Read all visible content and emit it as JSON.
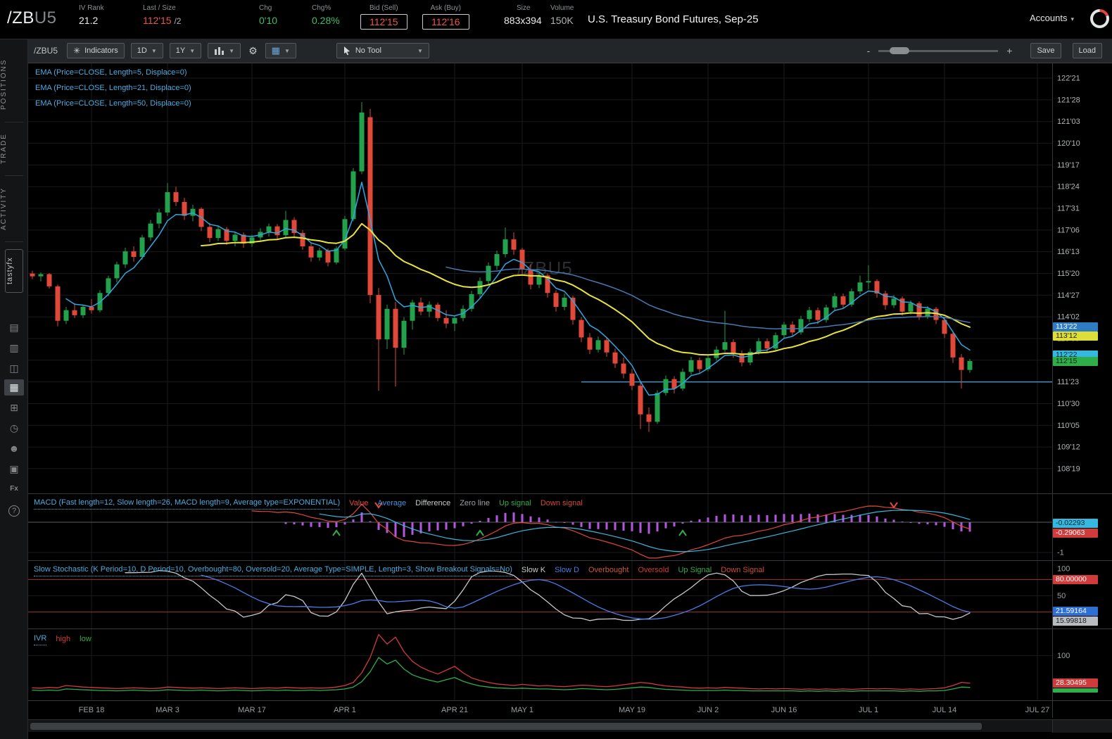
{
  "header": {
    "symbol": "/ZB",
    "symbol_suffix": "U5",
    "iv_rank_label": "IV Rank",
    "iv_rank": "21.2",
    "last_size_label": "Last / Size",
    "last": "112'15",
    "last_size": "/2",
    "chg_label": "Chg",
    "chg": "0'10",
    "chg_pct_label": "Chg%",
    "chg_pct": "0.28%",
    "bid_label": "Bid (Sell)",
    "bid": "112'15",
    "ask_label": "Ask (Buy)",
    "ask": "112'16",
    "size_label": "Size",
    "size": "883x394",
    "volume_label": "Volume",
    "volume": "150K",
    "title": "U.S. Treasury Bond Futures, Sep-25",
    "accounts_label": "Accounts"
  },
  "sidebar": {
    "tabs": [
      {
        "label": "POSITIONS"
      },
      {
        "label": "TRADE"
      },
      {
        "label": "ACTIVITY"
      },
      {
        "label": "tastyfx"
      }
    ],
    "icons": [
      {
        "name": "statement-icon",
        "glyph": "▤"
      },
      {
        "name": "watchlist-icon",
        "glyph": "▥"
      },
      {
        "name": "notes-icon",
        "glyph": "◫"
      },
      {
        "name": "chart-icon",
        "glyph": "▦",
        "active": true
      },
      {
        "name": "widgets-icon",
        "glyph": "⊞"
      },
      {
        "name": "history-icon",
        "glyph": "◷"
      },
      {
        "name": "contacts-icon",
        "glyph": "☻"
      },
      {
        "name": "calendar-icon",
        "glyph": "▣"
      },
      {
        "name": "functions-icon",
        "glyph": "Fx",
        "shape": "boxed"
      },
      {
        "name": "help-icon",
        "glyph": "?",
        "shape": "round"
      }
    ]
  },
  "toolbar": {
    "symbol_label": "/ZBU5",
    "indicators_label": "Indicators",
    "timeframe": "1D",
    "range": "1Y",
    "tool_label": "No Tool",
    "zoom_minus": "-",
    "zoom_plus": "+",
    "save_label": "Save",
    "load_label": "Load"
  },
  "chart_data": {
    "type": "candlestick",
    "symbol": "/ZBU5",
    "watermark": "/ZBU5",
    "price_format": "32nds",
    "candles": [
      [
        115.62,
        115.72,
        115.42,
        115.52
      ],
      [
        115.52,
        115.66,
        115.34,
        115.6
      ],
      [
        115.6,
        115.64,
        115.08,
        115.16
      ],
      [
        115.16,
        115.22,
        113.72,
        113.92
      ],
      [
        113.92,
        114.42,
        113.8,
        114.3
      ],
      [
        114.3,
        114.55,
        114.02,
        114.12
      ],
      [
        114.12,
        114.5,
        114.02,
        114.42
      ],
      [
        114.42,
        114.7,
        114.18,
        114.3
      ],
      [
        114.3,
        115.02,
        114.22,
        114.92
      ],
      [
        114.92,
        115.55,
        114.8,
        115.45
      ],
      [
        115.45,
        116.05,
        115.3,
        115.95
      ],
      [
        115.95,
        116.55,
        115.82,
        116.42
      ],
      [
        116.42,
        116.6,
        116.05,
        116.22
      ],
      [
        116.22,
        117.02,
        116.12,
        116.92
      ],
      [
        116.92,
        117.55,
        116.8,
        117.42
      ],
      [
        117.42,
        117.95,
        117.25,
        117.82
      ],
      [
        117.82,
        118.88,
        117.7,
        118.55
      ],
      [
        118.55,
        118.75,
        118.05,
        118.2
      ],
      [
        118.2,
        118.35,
        117.55,
        117.7
      ],
      [
        117.7,
        118.1,
        117.5,
        117.95
      ],
      [
        117.95,
        118.0,
        117.15,
        117.3
      ],
      [
        117.3,
        117.45,
        116.75,
        116.9
      ],
      [
        116.9,
        117.35,
        116.8,
        117.22
      ],
      [
        117.22,
        117.3,
        116.65,
        116.8
      ],
      [
        116.8,
        117.12,
        116.6,
        117.02
      ],
      [
        117.02,
        117.1,
        116.55,
        116.7
      ],
      [
        116.7,
        117.02,
        116.58,
        116.92
      ],
      [
        116.92,
        117.25,
        116.8,
        117.12
      ],
      [
        117.12,
        117.42,
        116.95,
        117.32
      ],
      [
        117.32,
        117.4,
        116.85,
        117.0
      ],
      [
        117.0,
        117.88,
        116.92,
        117.55
      ],
      [
        117.55,
        117.65,
        116.95,
        117.08
      ],
      [
        117.08,
        117.18,
        116.48,
        116.6
      ],
      [
        116.6,
        116.72,
        116.05,
        116.2
      ],
      [
        116.2,
        116.55,
        116.08,
        116.45
      ],
      [
        116.45,
        116.52,
        115.88,
        116.02
      ],
      [
        116.02,
        116.6,
        115.95,
        116.52
      ],
      [
        116.52,
        117.7,
        116.45,
        117.58
      ],
      [
        117.58,
        119.42,
        117.5,
        119.3
      ],
      [
        119.3,
        121.8,
        119.2,
        121.42
      ],
      [
        121.25,
        121.55,
        114.55,
        114.85
      ],
      [
        114.85,
        115.1,
        111.4,
        113.25
      ],
      [
        113.25,
        114.5,
        112.9,
        114.35
      ],
      [
        114.35,
        114.6,
        111.55,
        112.95
      ],
      [
        112.95,
        114.05,
        112.7,
        113.92
      ],
      [
        113.92,
        114.68,
        113.6,
        114.58
      ],
      [
        114.58,
        114.75,
        114.12,
        114.25
      ],
      [
        114.25,
        114.62,
        114.05,
        114.5
      ],
      [
        114.5,
        114.58,
        113.9,
        114.02
      ],
      [
        114.02,
        114.3,
        113.65,
        113.82
      ],
      [
        113.82,
        114.12,
        113.55,
        114.02
      ],
      [
        114.02,
        114.48,
        113.9,
        114.35
      ],
      [
        114.35,
        115.0,
        114.25,
        114.88
      ],
      [
        114.88,
        115.48,
        114.75,
        115.35
      ],
      [
        115.35,
        116.02,
        115.22,
        115.9
      ],
      [
        115.9,
        116.45,
        115.75,
        116.32
      ],
      [
        116.32,
        117.28,
        116.2,
        116.85
      ],
      [
        116.85,
        117.1,
        116.3,
        116.48
      ],
      [
        116.48,
        116.55,
        115.6,
        115.78
      ],
      [
        115.78,
        115.95,
        115.05,
        115.22
      ],
      [
        115.22,
        115.7,
        115.1,
        115.55
      ],
      [
        115.55,
        115.62,
        114.75,
        114.92
      ],
      [
        114.92,
        115.02,
        114.25,
        114.42
      ],
      [
        114.42,
        114.9,
        114.3,
        114.75
      ],
      [
        114.75,
        114.82,
        113.78,
        113.95
      ],
      [
        113.95,
        114.05,
        113.15,
        113.32
      ],
      [
        113.32,
        113.48,
        112.72,
        112.88
      ],
      [
        112.88,
        113.35,
        112.78,
        113.22
      ],
      [
        113.22,
        113.32,
        112.62,
        112.78
      ],
      [
        112.78,
        112.92,
        112.22,
        112.38
      ],
      [
        112.38,
        112.6,
        111.85,
        112.02
      ],
      [
        112.02,
        112.18,
        111.42,
        111.58
      ],
      [
        111.58,
        111.7,
        110.02,
        110.55
      ],
      [
        110.55,
        110.8,
        109.92,
        110.28
      ],
      [
        110.28,
        111.42,
        110.2,
        111.32
      ],
      [
        111.32,
        111.95,
        111.22,
        111.82
      ],
      [
        111.82,
        111.92,
        111.3,
        111.48
      ],
      [
        111.48,
        112.2,
        111.4,
        112.08
      ],
      [
        112.08,
        112.62,
        111.98,
        112.5
      ],
      [
        112.5,
        112.6,
        112.05,
        112.18
      ],
      [
        112.18,
        112.7,
        112.1,
        112.58
      ],
      [
        112.58,
        113.0,
        112.48,
        112.88
      ],
      [
        112.88,
        114.28,
        112.8,
        113.15
      ],
      [
        113.15,
        113.25,
        112.58,
        112.72
      ],
      [
        112.72,
        112.85,
        112.28,
        112.42
      ],
      [
        112.42,
        112.92,
        112.32,
        112.8
      ],
      [
        112.8,
        113.3,
        112.7,
        113.18
      ],
      [
        113.18,
        113.28,
        112.78,
        112.92
      ],
      [
        112.92,
        113.5,
        112.85,
        113.4
      ],
      [
        113.4,
        113.88,
        113.3,
        113.78
      ],
      [
        113.78,
        113.9,
        113.35,
        113.5
      ],
      [
        113.5,
        114.1,
        113.42,
        113.98
      ],
      [
        113.98,
        114.42,
        113.88,
        114.3
      ],
      [
        114.3,
        114.4,
        113.8,
        113.95
      ],
      [
        113.95,
        114.5,
        113.85,
        114.4
      ],
      [
        114.4,
        114.92,
        114.3,
        114.8
      ],
      [
        114.8,
        114.9,
        114.35,
        114.5
      ],
      [
        114.5,
        115.08,
        114.42,
        114.98
      ],
      [
        114.98,
        115.55,
        114.88,
        115.3
      ],
      [
        115.3,
        115.92,
        115.05,
        115.35
      ],
      [
        115.35,
        115.42,
        114.75,
        114.9
      ],
      [
        114.9,
        115.0,
        114.32,
        114.48
      ],
      [
        114.48,
        114.85,
        114.38,
        114.72
      ],
      [
        114.72,
        114.8,
        114.1,
        114.25
      ],
      [
        114.25,
        114.65,
        114.15,
        114.55
      ],
      [
        114.55,
        114.62,
        113.95,
        114.08
      ],
      [
        114.08,
        114.45,
        113.98,
        114.35
      ],
      [
        114.35,
        114.42,
        113.8,
        113.95
      ],
      [
        113.95,
        114.05,
        113.3,
        113.45
      ],
      [
        113.45,
        113.55,
        112.4,
        112.6
      ],
      [
        112.6,
        112.72,
        111.48,
        112.15
      ],
      [
        112.15,
        112.55,
        112.05,
        112.47
      ]
    ],
    "overlays": [
      {
        "name": "EMA",
        "length": 5,
        "color": "#2fa7e0"
      },
      {
        "name": "EMA",
        "length": 21,
        "color": "#e8e33c"
      },
      {
        "name": "EMA",
        "length": 50,
        "color": "#4679b2"
      }
    ],
    "legend": [
      {
        "label": "EMA (Price=CLOSE, Length=5, Displace=0)",
        "color": "#4cacdf"
      },
      {
        "label": "EMA (Price=CLOSE, Length=21, Displace=0)",
        "color": "#4cacdf"
      },
      {
        "label": "EMA (Price=CLOSE, Length=50, Displace=0)",
        "color": "#4cacdf"
      }
    ],
    "candle_up_color": "#23a24b",
    "candle_down_color": "#e0493a",
    "support_line": {
      "label": "111'23",
      "value": 111.71875,
      "start_index": 65,
      "color": "#4a90c4"
    },
    "price_axis_labels": [
      "122'21",
      "121'28",
      "121'03",
      "120'10",
      "119'17",
      "118'24",
      "117'31",
      "117'06",
      "116'13",
      "115'20",
      "114'27",
      "114'02",
      "113'09",
      "112'16",
      "111'23",
      "110'30",
      "110'05",
      "109'12",
      "108'19"
    ],
    "price_axis_tags": [
      {
        "text": "113'22",
        "value": 113.6875,
        "bg": "#2e7cc4",
        "fg": "#ffffff"
      },
      {
        "text": "113'12",
        "value": 113.375,
        "bg": "#ddde3a",
        "fg": "#1a1c00"
      },
      {
        "text": "112'22",
        "value": 112.6875,
        "bg": "#35b9e0",
        "fg": "#062530"
      },
      {
        "text": "112'15",
        "value": 112.46875,
        "bg": "#2fae4a",
        "fg": "#06230f"
      }
    ],
    "time_axis": [
      {
        "label": "FEB 18",
        "i": 7
      },
      {
        "label": "MAR 3",
        "i": 16
      },
      {
        "label": "MAR 17",
        "i": 26
      },
      {
        "label": "APR 1",
        "i": 37
      },
      {
        "label": "APR 21",
        "i": 50
      },
      {
        "label": "MAY 1",
        "i": 58
      },
      {
        "label": "MAY 19",
        "i": 71
      },
      {
        "label": "JUN 2",
        "i": 80
      },
      {
        "label": "JUN 16",
        "i": 89
      },
      {
        "label": "JUL 1",
        "i": 99
      },
      {
        "label": "JUL 14",
        "i": 108
      },
      {
        "label": "JUL 27",
        "i": 119
      }
    ],
    "macd": {
      "title": "MACD (Fast length=12, Slow length=26, MACD length=9, Average type=EXPONENTIAL)",
      "title_color": "#4cacdf",
      "items": [
        {
          "label": "Value",
          "color": "#e0483c"
        },
        {
          "label": "Average",
          "color": "#4a90d9"
        },
        {
          "label": "Difference",
          "color": "#c8cbcd"
        },
        {
          "label": "Zero line",
          "color": "#9ca0a3"
        },
        {
          "label": "Up signal",
          "color": "#2fae4a"
        },
        {
          "label": "Down signal",
          "color": "#d04a3a"
        }
      ],
      "fast_length": 12,
      "slow_length": 26,
      "macd_length": 9,
      "value_color": "#e0483c",
      "average_color": "#35b9e0",
      "histogram_color": "#b358de",
      "up_signals": [
        36,
        53,
        77
      ],
      "down_signals": [
        41,
        102
      ],
      "axis_tags": [
        {
          "text": "-0.02293",
          "value": -0.02293,
          "bg": "#35b9e0",
          "fg": "#07222b"
        },
        {
          "text": "-0.29063",
          "value": -0.29063,
          "bg": "#d23b3b",
          "fg": "#ffffff"
        }
      ],
      "axis_labels": [
        {
          "text": "-1",
          "value": -1
        }
      ]
    },
    "stochastic": {
      "title": "Slow Stochastic (K Period=10, D Period=10, Overbought=80, Oversold=20, Average Type=SIMPLE, Length=3, Show Breakout Signals=No)",
      "title_color": "#4cacdf",
      "items": [
        {
          "label": "Slow K",
          "color": "#c8cbcd"
        },
        {
          "label": "Slow D",
          "color": "#4a7de8"
        },
        {
          "label": "Overbought",
          "color": "#cc5a35"
        },
        {
          "label": "Oversold",
          "color": "#d23b3b"
        },
        {
          "label": "Up Signal",
          "color": "#2fae4a"
        },
        {
          "label": "Down Signal",
          "color": "#d04a3a"
        }
      ],
      "k_period": 10,
      "d_period": 10,
      "overbought": 80,
      "oversold": 20,
      "k_color": "#c4c7c9",
      "d_color": "#4a7de8",
      "band_color": "#a03434",
      "axis_tags": [
        {
          "text": "80.00000",
          "value": 80,
          "bg": "#d23b3b",
          "fg": "#ffffff"
        },
        {
          "text": "21.59164",
          "value": 21.59164,
          "bg": "#2e6fd4",
          "fg": "#ffffff"
        },
        {
          "text": "15.99818",
          "value": 15.99818,
          "bg": "#b9bdbf",
          "fg": "#1a1c1e"
        }
      ],
      "axis_labels": [
        {
          "text": "100",
          "value": 100
        },
        {
          "text": "50",
          "value": 50
        }
      ]
    },
    "ivr": {
      "title": "IVR",
      "title_color": "#4cacdf",
      "items": [
        {
          "label": "high",
          "color": "#d23b3b"
        },
        {
          "label": "low",
          "color": "#2fae4a"
        }
      ],
      "high_color": "#d23b3b",
      "low_color": "#2fae4a",
      "high": [
        16,
        15,
        17,
        16,
        22,
        20,
        18,
        17,
        16,
        15,
        14,
        15,
        16,
        15,
        14,
        15,
        18,
        17,
        16,
        15,
        16,
        15,
        14,
        15,
        16,
        15,
        14,
        15,
        16,
        15,
        17,
        16,
        15,
        16,
        15,
        16,
        18,
        22,
        30,
        55,
        95,
        155,
        130,
        148,
        110,
        85,
        70,
        60,
        52,
        62,
        72,
        55,
        42,
        35,
        30,
        26,
        24,
        22,
        25,
        23,
        21,
        22,
        20,
        19,
        21,
        23,
        22,
        20,
        19,
        21,
        24,
        27,
        30,
        28,
        24,
        21,
        19,
        18,
        16,
        15,
        16,
        15,
        17,
        16,
        15,
        14,
        13,
        14,
        13,
        14,
        13,
        12,
        13,
        12,
        13,
        12,
        13,
        12,
        13,
        14,
        13,
        14,
        13,
        12,
        13,
        12,
        13,
        14,
        16,
        22,
        30,
        28.3
      ],
      "low": [
        10,
        9,
        10,
        9,
        13,
        12,
        11,
        10,
        9,
        9,
        8,
        9,
        10,
        9,
        8,
        9,
        11,
        10,
        9,
        9,
        10,
        9,
        8,
        9,
        10,
        9,
        8,
        9,
        10,
        9,
        10,
        9,
        9,
        10,
        9,
        10,
        11,
        13,
        18,
        32,
        58,
        95,
        78,
        88,
        65,
        50,
        42,
        36,
        31,
        37,
        43,
        33,
        26,
        21,
        18,
        16,
        15,
        14,
        15,
        14,
        13,
        13,
        12,
        11,
        12,
        14,
        13,
        12,
        11,
        12,
        14,
        16,
        18,
        17,
        14,
        12,
        11,
        10,
        9,
        9,
        9,
        9,
        10,
        9,
        9,
        8,
        8,
        8,
        8,
        8,
        8,
        7,
        8,
        7,
        8,
        7,
        8,
        7,
        8,
        8,
        8,
        8,
        8,
        7,
        8,
        7,
        8,
        8,
        9,
        13,
        18,
        17
      ],
      "axis_tags": [
        {
          "text": "28.30495",
          "value": 28.30495,
          "bg": "#d23b3b",
          "fg": "#ffffff"
        },
        {
          "text": "",
          "value": 22,
          "bg": "#2fae4a",
          "fg": "#ffffff",
          "h": 6
        }
      ],
      "axis_labels": [
        {
          "text": "100",
          "value": 100
        }
      ]
    }
  }
}
